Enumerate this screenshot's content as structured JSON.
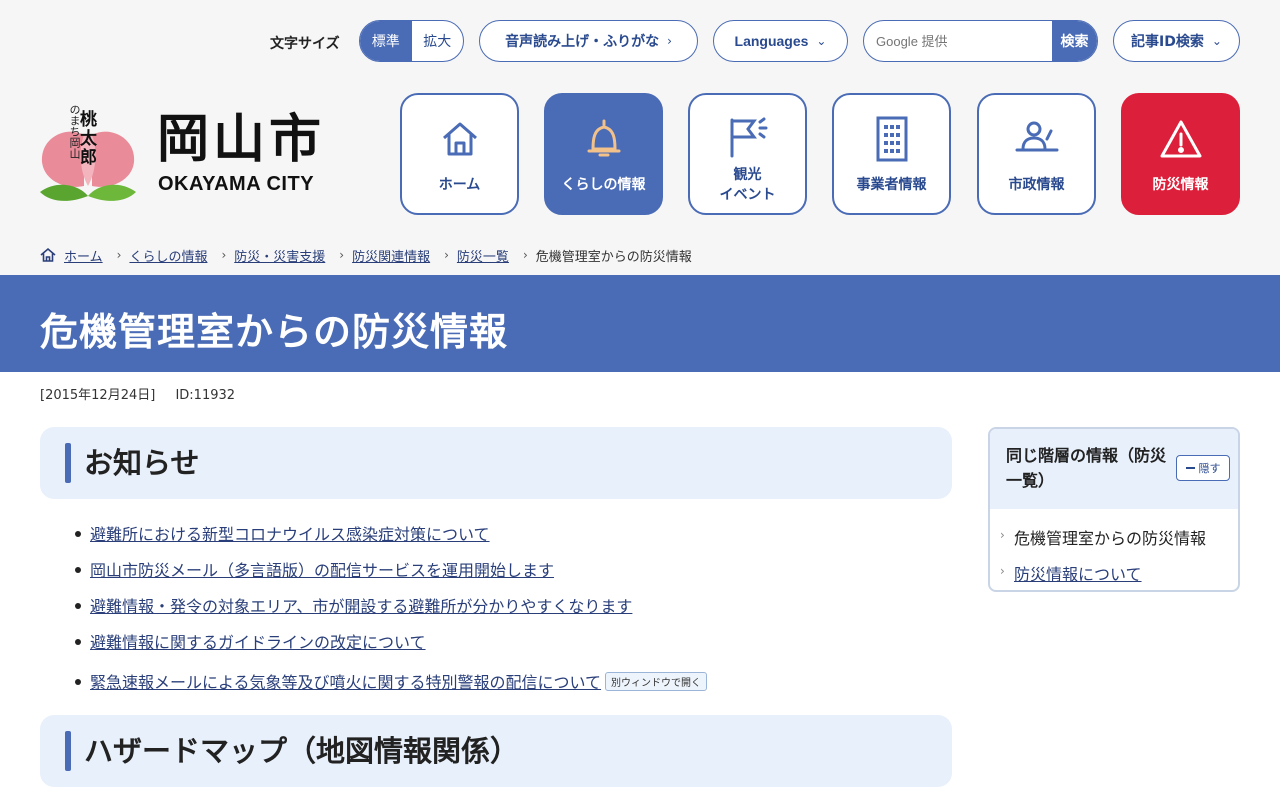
{
  "utility": {
    "font_size_label": "文字サイズ",
    "font_size_standard": "標準",
    "font_size_large": "拡大",
    "read_aloud": "音声読み上げ・ふりがな",
    "languages": "Languages",
    "search_placeholder": "Google 提供",
    "search_button": "検索",
    "article_id_search": "記事ID検索"
  },
  "logo": {
    "city_name_kanji": "岡山市",
    "city_name_latin": "OKAYAMA CITY",
    "mascot_caption": "のまち岡山",
    "mascot_tag": "桃太郎"
  },
  "nav": [
    {
      "label": "ホーム",
      "icon": "home-icon"
    },
    {
      "label": "くらしの情報",
      "icon": "bell-icon"
    },
    {
      "label": "観光\nイベント",
      "icon": "flag-icon"
    },
    {
      "label": "事業者情報",
      "icon": "building-icon"
    },
    {
      "label": "市政情報",
      "icon": "person-desk-icon"
    },
    {
      "label": "防災情報",
      "icon": "warning-icon"
    }
  ],
  "breadcrumb": {
    "items": [
      "ホーム",
      "くらしの情報",
      "防災・災害支援",
      "防災関連情報",
      "防災一覧"
    ],
    "current": "危機管理室からの防災情報"
  },
  "page": {
    "title": "危機管理室からの防災情報",
    "date": "[2015年12月24日]",
    "id": "ID:11932"
  },
  "sections": [
    {
      "heading": "お知らせ"
    },
    {
      "heading": "ハザードマップ（地図情報関係）"
    }
  ],
  "news": [
    "避難所における新型コロナウイルス感染症対策について",
    "岡山市防災メール（多言語版）の配信サービスを運用開始します",
    "避難情報・発令の対象エリア、市が開設する避難所が分かりやすくなります",
    "避難情報に関するガイドラインの改定について",
    "緊急速報メールによる気象等及び噴火に関する特別警報の配信について"
  ],
  "external_badge": "別ウィンドウで開く",
  "sidebar": {
    "title": "同じ階層の情報（防災一覧）",
    "hide_label": "隠す",
    "items": [
      "危機管理室からの防災情報",
      "防災情報について"
    ]
  },
  "colors": {
    "primary": "#4a6bb5",
    "disaster": "#dc1f3a",
    "light_bg": "#e8f0fb"
  }
}
